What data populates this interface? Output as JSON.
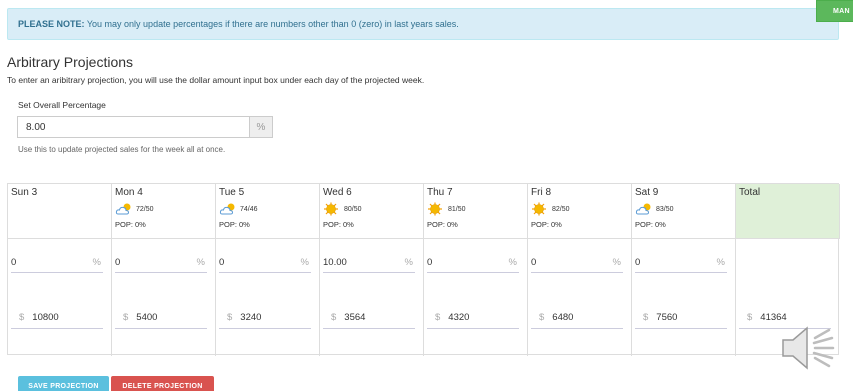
{
  "note": {
    "label": "PLEASE NOTE:",
    "text": " You may only update percentages if there are numbers other than 0 (zero) in last years sales."
  },
  "manage_button": "MAN",
  "section": {
    "title": "Arbitrary Projections",
    "subtitle": "To enter an aribitrary projection, you will use the dollar amount input box under each day of the projected week."
  },
  "overall": {
    "label": "Set Overall Percentage",
    "value": "8.00",
    "addon": "%",
    "help": "Use this to update projected sales for the week all at once."
  },
  "days": [
    {
      "label": "Sun 3",
      "weather": "",
      "temp": "",
      "pop": "",
      "percent": "0",
      "amount": "10800"
    },
    {
      "label": "Mon 4",
      "weather": "partly-cloudy",
      "temp": "72/50",
      "pop": "POP: 0%",
      "percent": "0",
      "amount": "5400"
    },
    {
      "label": "Tue 5",
      "weather": "partly-cloudy",
      "temp": "74/46",
      "pop": "POP: 0%",
      "percent": "0",
      "amount": "3240"
    },
    {
      "label": "Wed 6",
      "weather": "sunny",
      "temp": "80/50",
      "pop": "POP: 0%",
      "percent": "10.00",
      "amount": "3564"
    },
    {
      "label": "Thu 7",
      "weather": "sunny",
      "temp": "81/50",
      "pop": "POP: 0%",
      "percent": "0",
      "amount": "4320"
    },
    {
      "label": "Fri 8",
      "weather": "sunny",
      "temp": "82/50",
      "pop": "POP: 0%",
      "percent": "0",
      "amount": "6480"
    },
    {
      "label": "Sat 9",
      "weather": "partly-cloudy",
      "temp": "83/50",
      "pop": "POP: 0%",
      "percent": "0",
      "amount": "7560"
    }
  ],
  "total": {
    "label": "Total",
    "amount": "41364"
  },
  "symbols": {
    "percent": "%",
    "dollar": "$"
  },
  "buttons": {
    "save": "SAVE PROJECTION",
    "delete": "DELETE PROJECTION"
  },
  "colors": {
    "note_bg": "#d9edf7",
    "total_bg": "#dff0d8",
    "save": "#5bc0de",
    "delete": "#d9534f",
    "manage": "#5cb85c"
  }
}
